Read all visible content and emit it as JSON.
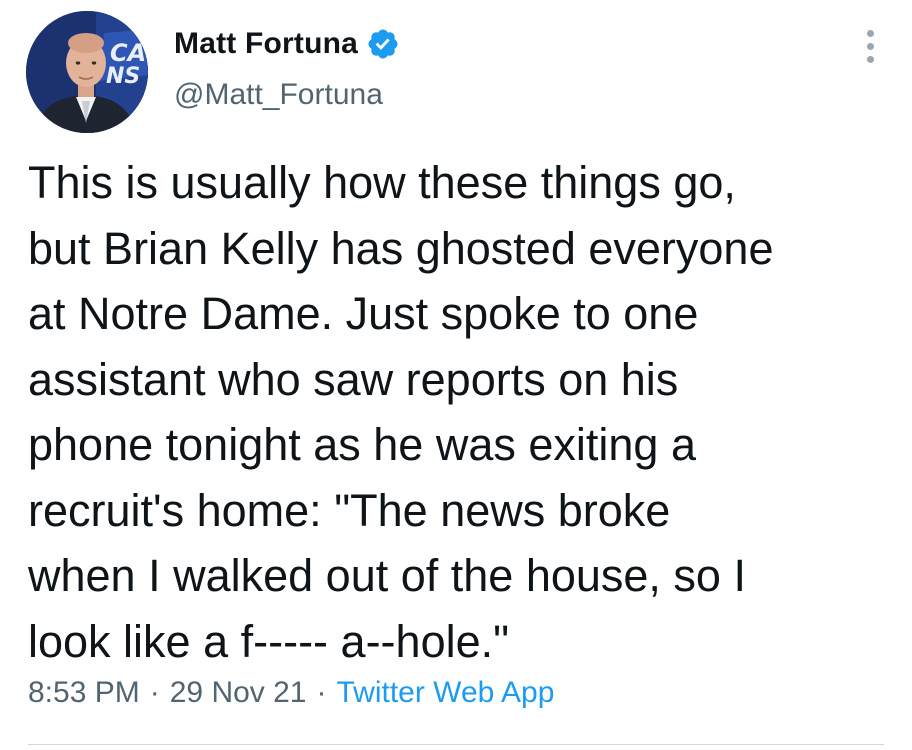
{
  "author": {
    "display_name": "Matt Fortuna",
    "handle": "@Matt_Fortuna",
    "verified": true,
    "avatar_backdrop_text": "CA\nNS"
  },
  "tweet": {
    "text_lines": [
      "This is usually how these things go,",
      "but Brian Kelly has ghosted everyone",
      "at Notre Dame. Just spoke to one",
      "assistant who saw reports on his",
      "phone tonight as he was exiting a",
      "recruit's home: \"The news broke",
      "when I walked out of the house, so I",
      "look like a f----- a--hole.\""
    ]
  },
  "meta": {
    "time": "8:53 PM",
    "separator": "·",
    "date": "29 Nov 21",
    "source": "Twitter Web App"
  },
  "colors": {
    "verified_badge": "#1d9bf0",
    "link": "#1d9bf0",
    "secondary_text": "#536471",
    "primary_text": "#0f1419"
  },
  "icons": {
    "verified": "verified-badge-icon",
    "more": "more-options-icon"
  }
}
